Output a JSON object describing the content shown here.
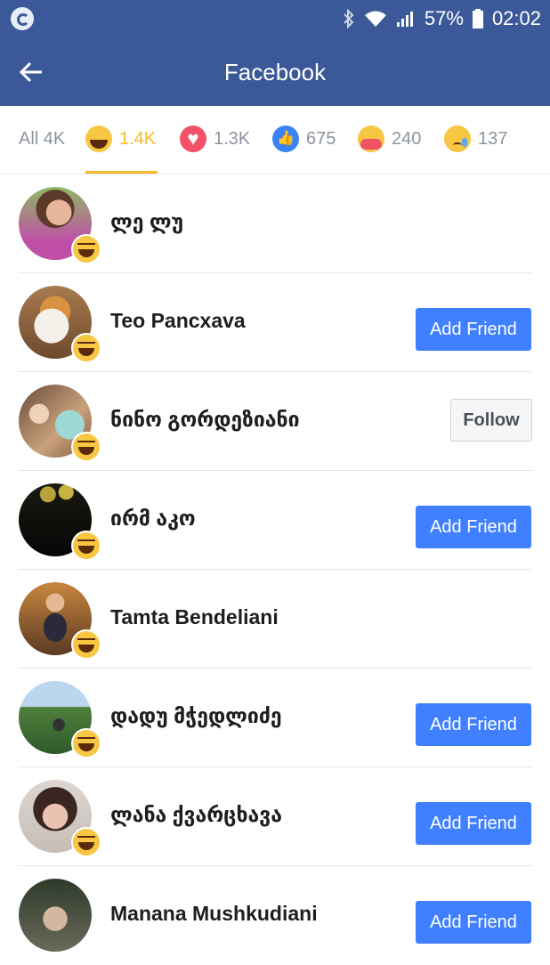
{
  "status_bar": {
    "battery": "57%",
    "time": "02:02"
  },
  "header": {
    "title": "Facebook",
    "back_icon": "arrow-left-icon"
  },
  "tabs": [
    {
      "label": "All 4K",
      "icon": "",
      "active": false
    },
    {
      "label": "1.4K",
      "icon": "haha-reaction-icon",
      "active": true
    },
    {
      "label": "1.3K",
      "icon": "love-reaction-icon",
      "active": false
    },
    {
      "label": "675",
      "icon": "like-reaction-icon",
      "active": false
    },
    {
      "label": "240",
      "icon": "care-reaction-icon",
      "active": false
    },
    {
      "label": "137",
      "icon": "sad-reaction-icon",
      "active": false
    }
  ],
  "people": [
    {
      "name": "ლე ლუ",
      "action": ""
    },
    {
      "name": "Teo Pancxava",
      "action": "Add Friend"
    },
    {
      "name": "ნინო გორდეზიანი",
      "action": "Follow"
    },
    {
      "name": "ირმ აკო",
      "action": "Add Friend"
    },
    {
      "name": "Tamta Bendeliani",
      "action": ""
    },
    {
      "name": "დადუ მჭედლიძე",
      "action": "Add Friend"
    },
    {
      "name": "ლანა ქვარცხავა",
      "action": "Add Friend"
    },
    {
      "name": "Manana Mushkudiani",
      "action": "Add Friend"
    }
  ],
  "colors": {
    "brand_blue": "#3b5998",
    "button_blue": "#4080ff",
    "active_tab": "#f7b928"
  }
}
